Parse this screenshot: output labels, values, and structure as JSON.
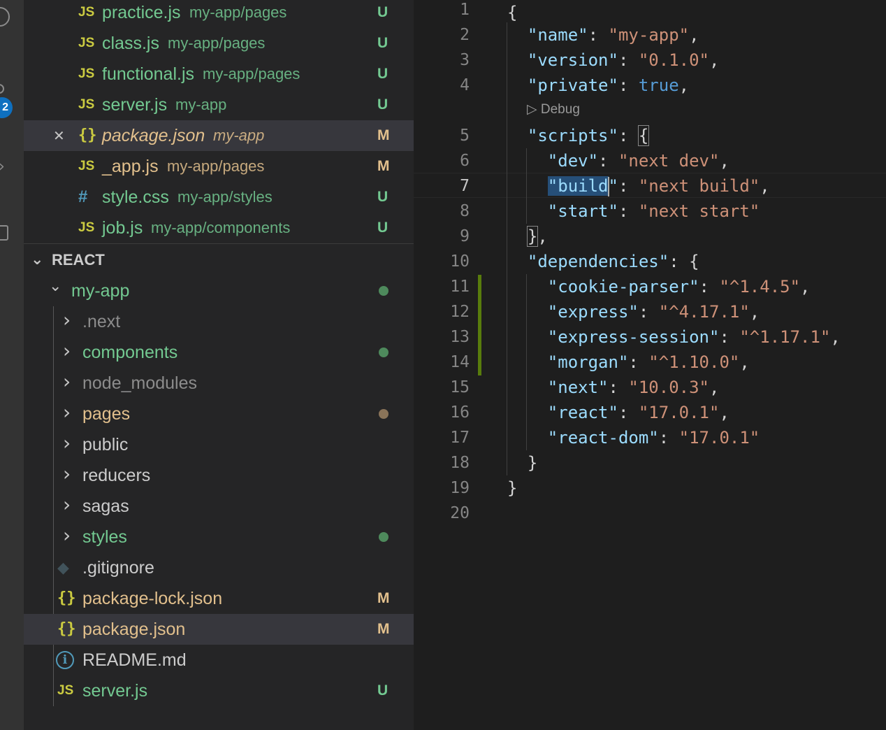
{
  "activity_bar": {
    "icons": [
      "history-icon",
      "source-control-icon",
      "run-debug-icon",
      "extensions-icon"
    ],
    "scm_badge": "2"
  },
  "open_editors": [
    {
      "icon": "JS",
      "name": "practice.js",
      "path": "my-app/pages",
      "status": "U",
      "color": "#73c991"
    },
    {
      "icon": "JS",
      "name": "class.js",
      "path": "my-app/pages",
      "status": "U",
      "color": "#73c991"
    },
    {
      "icon": "JS",
      "name": "functional.js",
      "path": "my-app/pages",
      "status": "U",
      "color": "#73c991"
    },
    {
      "icon": "JS",
      "name": "server.js",
      "path": "my-app",
      "status": "U",
      "color": "#73c991"
    },
    {
      "icon": "{}",
      "name": "package.json",
      "path": "my-app",
      "status": "M",
      "color": "#e2c08d",
      "active": true
    },
    {
      "icon": "JS",
      "name": "_app.js",
      "path": "my-app/pages",
      "status": "M",
      "color": "#e2c08d"
    },
    {
      "icon": "#",
      "name": "style.css",
      "path": "my-app/styles",
      "status": "U",
      "color": "#73c991"
    },
    {
      "icon": "JS",
      "name": "job.js",
      "path": "my-app/components",
      "status": "U",
      "color": "#73c991"
    }
  ],
  "explorer": {
    "section_title": "REACT",
    "root_folder": "my-app",
    "folders": [
      {
        "name": ".next",
        "decoration": "none"
      },
      {
        "name": "components",
        "decoration": "green-dot"
      },
      {
        "name": "node_modules",
        "decoration": "none"
      },
      {
        "name": "pages",
        "decoration": "orange-dot"
      },
      {
        "name": "public",
        "decoration": "none"
      },
      {
        "name": "reducers",
        "decoration": "none"
      },
      {
        "name": "sagas",
        "decoration": "none"
      },
      {
        "name": "styles",
        "decoration": "green-dot"
      }
    ],
    "files": [
      {
        "icon": "git",
        "name": ".gitignore",
        "status": ""
      },
      {
        "icon": "{}",
        "name": "package-lock.json",
        "status": "M"
      },
      {
        "icon": "{}",
        "name": "package.json",
        "status": "M",
        "selected": true
      },
      {
        "icon": "i",
        "name": "README.md",
        "status": ""
      },
      {
        "icon": "JS",
        "name": "server.js",
        "status": "U"
      }
    ]
  },
  "editor": {
    "codelens": "▷ Debug",
    "active_line": 7,
    "line_numbers": [
      "1",
      "2",
      "3",
      "4",
      "5",
      "6",
      "7",
      "8",
      "9",
      "10",
      "11",
      "12",
      "13",
      "14",
      "15",
      "16",
      "17",
      "18",
      "19",
      "20"
    ]
  }
}
